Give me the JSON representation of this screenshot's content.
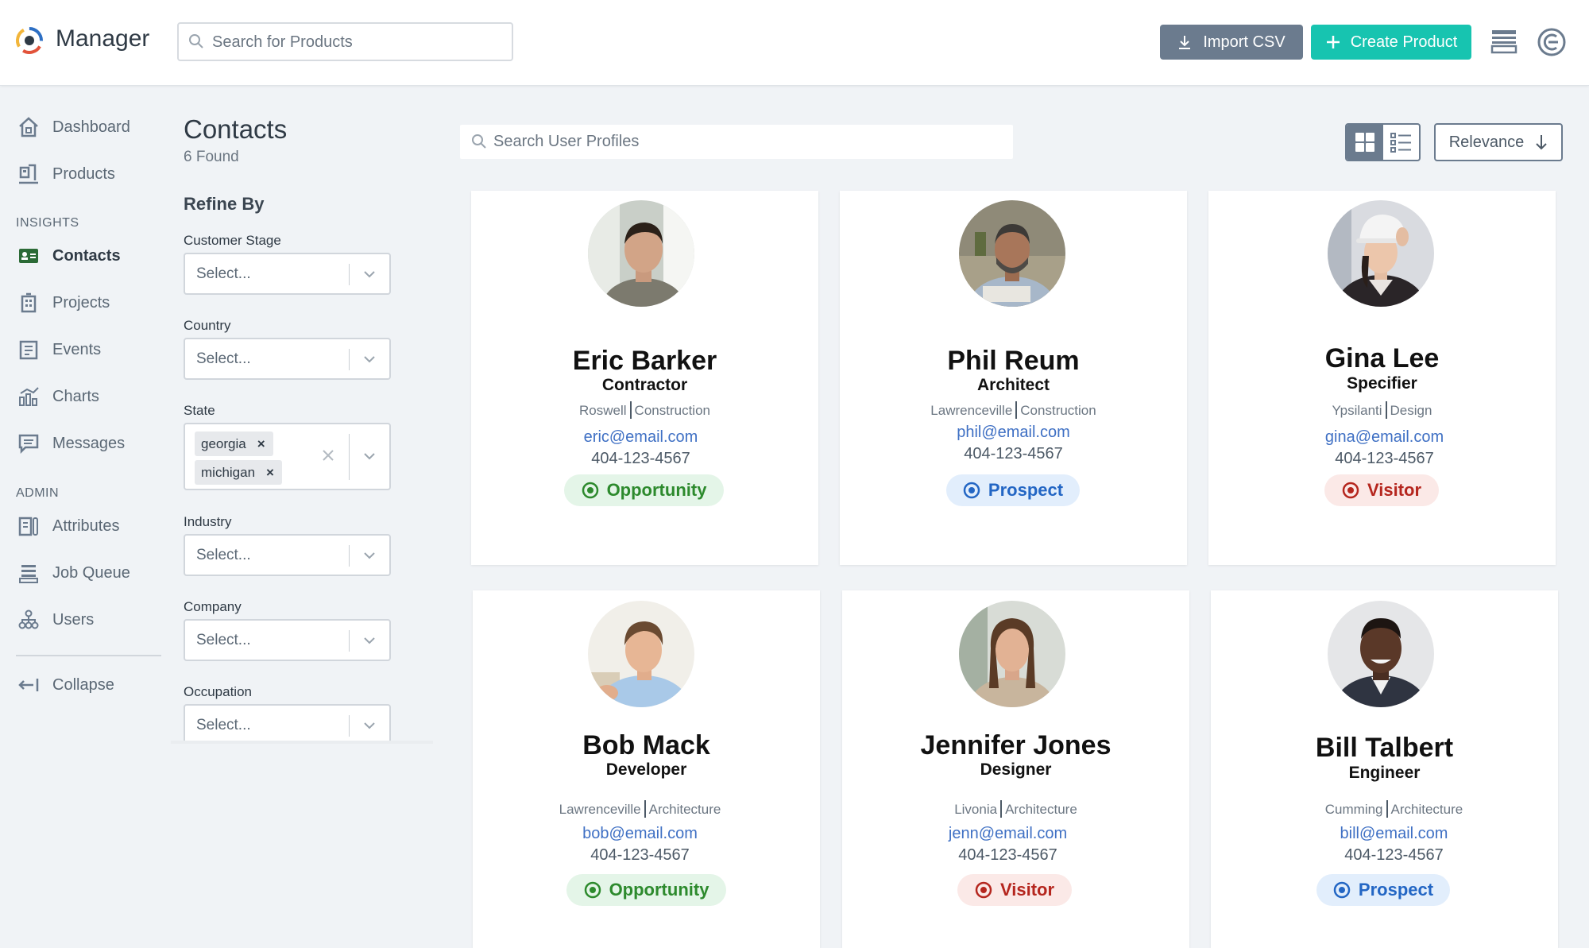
{
  "app": {
    "title": "Manager"
  },
  "header": {
    "search_placeholder": "Search for Products",
    "import_label": "Import CSV",
    "create_label": "Create Product"
  },
  "nav": {
    "main": [
      {
        "label": "Dashboard",
        "icon": "home-icon"
      },
      {
        "label": "Products",
        "icon": "products-icon"
      }
    ],
    "insights_label": "INSIGHTS",
    "insights": [
      {
        "label": "Contacts",
        "icon": "contacts-icon",
        "active": true
      },
      {
        "label": "Projects",
        "icon": "projects-icon"
      },
      {
        "label": "Events",
        "icon": "events-icon"
      },
      {
        "label": "Charts",
        "icon": "charts-icon"
      },
      {
        "label": "Messages",
        "icon": "messages-icon"
      }
    ],
    "admin_label": "ADMIN",
    "admin": [
      {
        "label": "Attributes",
        "icon": "attributes-icon"
      },
      {
        "label": "Job Queue",
        "icon": "job-queue-icon"
      },
      {
        "label": "Users",
        "icon": "users-icon"
      }
    ],
    "collapse_label": "Collapse"
  },
  "filters": {
    "title": "Contacts",
    "found": "6 Found",
    "refine_label": "Refine By",
    "customer_stage": {
      "label": "Customer Stage",
      "placeholder": "Select..."
    },
    "country": {
      "label": "Country",
      "placeholder": "Select..."
    },
    "state": {
      "label": "State",
      "values": [
        "georgia",
        "michigan"
      ],
      "remove_glyph": "×"
    },
    "industry": {
      "label": "Industry",
      "placeholder": "Select..."
    },
    "company": {
      "label": "Company",
      "placeholder": "Select..."
    },
    "occupation": {
      "label": "Occupation",
      "placeholder": "Select..."
    }
  },
  "content": {
    "search_placeholder": "Search User Profiles",
    "sort_label": "Relevance"
  },
  "contacts": [
    {
      "name": "Eric Barker",
      "role": "Contractor",
      "city": "Roswell",
      "industry": "Construction",
      "email": "eric@email.com",
      "phone": "404-123-4567",
      "status": "Opportunity"
    },
    {
      "name": "Phil Reum",
      "role": "Architect",
      "city": "Lawrenceville",
      "industry": "Construction",
      "email": "phil@email.com",
      "phone": "404-123-4567",
      "status": "Prospect"
    },
    {
      "name": "Gina Lee",
      "role": "Specifier",
      "city": "Ypsilanti",
      "industry": "Design",
      "email": "gina@email.com",
      "phone": "404-123-4567",
      "status": "Visitor"
    },
    {
      "name": "Bob Mack",
      "role": "Developer",
      "city": "Lawrenceville",
      "industry": "Architecture",
      "email": "bob@email.com",
      "phone": "404-123-4567",
      "status": "Opportunity"
    },
    {
      "name": "Jennifer Jones",
      "role": "Designer",
      "city": "Livonia",
      "industry": "Architecture",
      "email": "jenn@email.com",
      "phone": "404-123-4567",
      "status": "Visitor"
    },
    {
      "name": "Bill Talbert",
      "role": "Engineer",
      "city": "Cumming",
      "industry": "Architecture",
      "email": "bill@email.com",
      "phone": "404-123-4567",
      "status": "Prospect"
    }
  ],
  "colors": {
    "accent": "#17c4b0",
    "button_gray": "#6b7b8e",
    "link": "#3f70c4",
    "opportunity": "#2d8a2d",
    "prospect": "#2366c4",
    "visitor": "#b5261e"
  }
}
